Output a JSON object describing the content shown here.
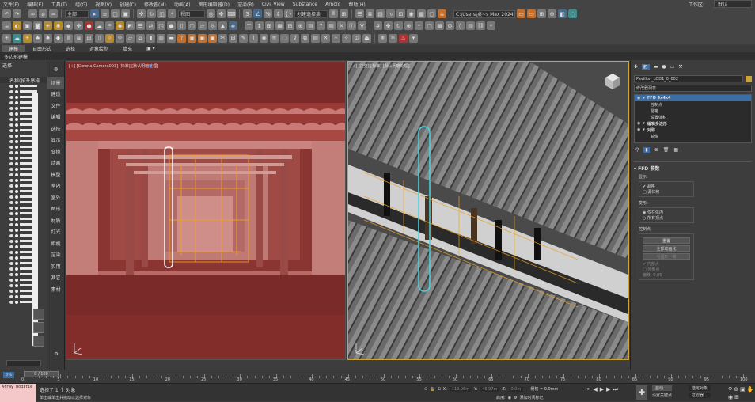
{
  "menu": [
    "文件(F)",
    "编辑(E)",
    "工具(T)",
    "组(G)",
    "视图(V)",
    "创建(C)",
    "修改器(M)",
    "动画(A)",
    "图形编辑器(D)",
    "渲染(R)",
    "Civil View",
    "Substance",
    "Arnold",
    "帮助(H)"
  ],
  "workspace": {
    "label": "工作区:",
    "value": "默认"
  },
  "toolbar1": {
    "selection_filter": "全部",
    "view_dropdown": "视图",
    "selection_set": "创建选择集",
    "project_path": "C:\\Users\\桌~s Max 2024"
  },
  "tabs": [
    "建模",
    "自由形式",
    "选择",
    "对象绘制",
    "填充"
  ],
  "ribbon_label": "多边形建模",
  "scene_explorer": {
    "title": "选择",
    "column": "名称(按升序排",
    "rows": 40
  },
  "command_bar": [
    "场景",
    "建造",
    "文件",
    "编辑",
    "选择",
    "显示",
    "变换",
    "动画",
    "模型",
    "室内",
    "室外",
    "图形",
    "材质",
    "灯光",
    "相机",
    "渲染",
    "实用",
    "其它",
    "素材"
  ],
  "viewport1": {
    "label": "[+] [Corona Camera003] [标准] [默认明暗处理]"
  },
  "viewport2": {
    "label": "[+] [正交] [标准] [默认明暗处理]"
  },
  "command_panel": {
    "object_name": "Pavilion_LOD1_0_002",
    "modifier_list": "修改器列表",
    "stack": [
      {
        "label": "FFD 4x4x4",
        "level": 0,
        "active": true
      },
      {
        "label": "控制点",
        "level": 1,
        "active": false
      },
      {
        "label": "晶格",
        "level": 1,
        "active": false
      },
      {
        "label": "设置体积",
        "level": 1,
        "active": false
      },
      {
        "label": "编辑多边形",
        "level": 0,
        "active": false
      },
      {
        "label": "对称",
        "level": 0,
        "active": false
      },
      {
        "label": "镜像",
        "level": 1,
        "active": false
      }
    ],
    "rollout_title": "FFD 参数",
    "display": {
      "title": "显示:",
      "options": [
        "晶格",
        "源体积"
      ]
    },
    "deform": {
      "title": "变形:",
      "options": [
        "仅在体内",
        "所有顶点"
      ]
    },
    "control_points": {
      "title": "控制点:",
      "buttons": [
        "重置",
        "全部动画化",
        "与图形一致",
        "内部点",
        "外部点",
        "偏移: 0.05"
      ]
    }
  },
  "timeline": {
    "frame": "0 / 100",
    "ticks": [
      "0",
      "5",
      "10",
      "15",
      "20",
      "25",
      "30",
      "35",
      "40",
      "45",
      "50",
      "55",
      "60",
      "65",
      "70",
      "75",
      "80",
      "85",
      "90",
      "95",
      "100"
    ]
  },
  "status": {
    "maxscript": "Array modifie",
    "selected": "选择了 1 个 对象",
    "prompt": "单击或单击并拖动以选择对象",
    "x_label": "X:",
    "x_value": "119.06m",
    "y_label": "Y:",
    "y_value": "46.97m",
    "z_label": "Z:",
    "z_value": "0.0m",
    "grid": "栅格 = 0.0mm",
    "enabled": "启用:",
    "add_time_tag": "添加时间标记",
    "auto_key": "自动",
    "selected_set": "选定对象",
    "set_key": "设置关键点",
    "key_filter": "过滤器..."
  },
  "colors": {
    "accent": "#c8a43a",
    "viewport_red": "#822d2a",
    "selection_blue": "#3a6ea5"
  }
}
